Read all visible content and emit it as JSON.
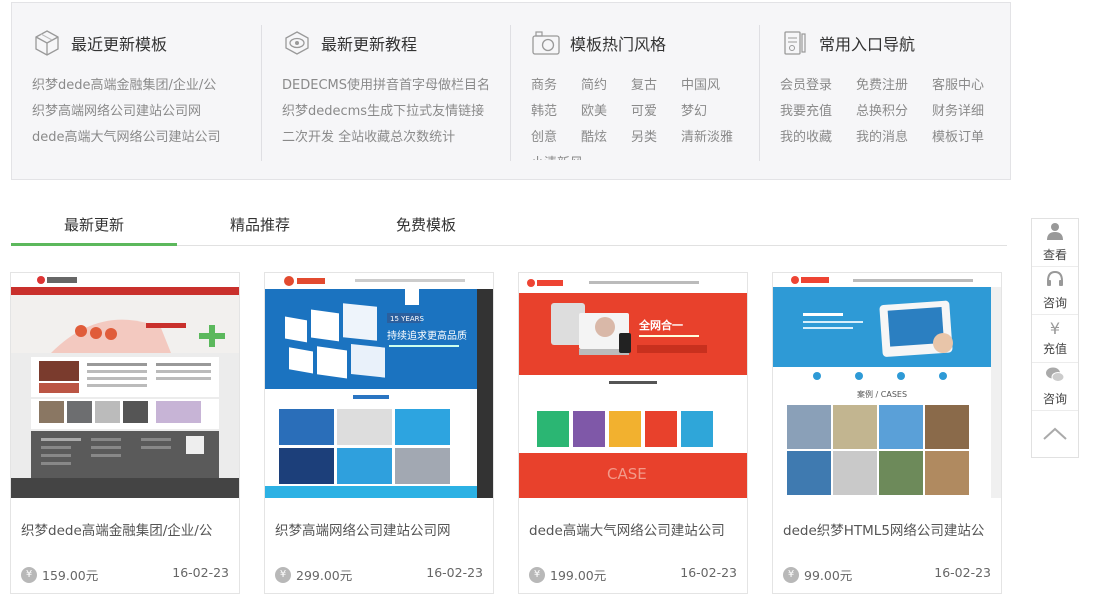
{
  "panel": {
    "sections": [
      {
        "title": "最近更新模板",
        "icon": "cube-icon",
        "lines": [
          "织梦dede高端金融集团/企业/公",
          "织梦高端网络公司建站公司网",
          "dede高端大气网络公司建站公司"
        ]
      },
      {
        "title": "最新更新教程",
        "icon": "eye-icon",
        "lines": [
          "DEDECMS使用拼音首字母做栏目名",
          "织梦dedecms生成下拉式友情链接",
          "二次开发 全站收藏总次数统计"
        ]
      },
      {
        "title": "模板热门风格",
        "icon": "camera-icon",
        "tags": [
          "商务",
          "简约",
          "复古",
          "中国风",
          "韩范",
          "欧美",
          "可爱",
          "梦幻",
          "创意",
          "酷炫",
          "另类",
          "清新淡雅"
        ],
        "overflow_tag": "小清新风"
      },
      {
        "title": "常用入口导航",
        "icon": "clipboard-icon",
        "links": [
          "会员登录",
          "免费注册",
          "客服中心",
          "我要充值",
          "总换积分",
          "财务详细",
          "我的收藏",
          "我的消息",
          "模板订单"
        ]
      }
    ]
  },
  "tabs": [
    {
      "label": "最新更新",
      "active": true
    },
    {
      "label": "精品推荐",
      "active": false
    },
    {
      "label": "免费模板",
      "active": false
    }
  ],
  "cards": [
    {
      "title": "织梦dede高端金融集团/企业/公",
      "price": "159.00元",
      "date": "16-02-23",
      "currency_icon": "¥"
    },
    {
      "title": "织梦高端网络公司建站公司网",
      "price": "299.00元",
      "date": "16-02-23",
      "currency_icon": "¥"
    },
    {
      "title": "dede高端大气网络公司建站公司",
      "price": "199.00元",
      "date": "16-02-23",
      "currency_icon": "¥"
    },
    {
      "title": "dede织梦HTML5网络公司建站公",
      "price": "99.00元",
      "date": "16-02-23",
      "currency_icon": "¥"
    }
  ],
  "thumb_text": {
    "t2_years": "15 YEARS",
    "t2_slogan": "持续追求更高品质",
    "t3_slogan": "全网合一",
    "t3_case": "CASE",
    "t4_case": "案例 / CASES"
  },
  "float_bar": [
    {
      "label": "查看",
      "icon": "user-icon"
    },
    {
      "label": "咨询",
      "icon": "headset-icon"
    },
    {
      "label": "充值",
      "icon": "yen-icon",
      "glyph": "¥"
    },
    {
      "label": "咨询",
      "icon": "wechat-icon"
    },
    {
      "label": "",
      "icon": "chevron-up-icon"
    }
  ],
  "colors": {
    "accent": "#5cb85c",
    "tab_line": "#5cb85c",
    "panel_bg": "#f6f6f8"
  }
}
